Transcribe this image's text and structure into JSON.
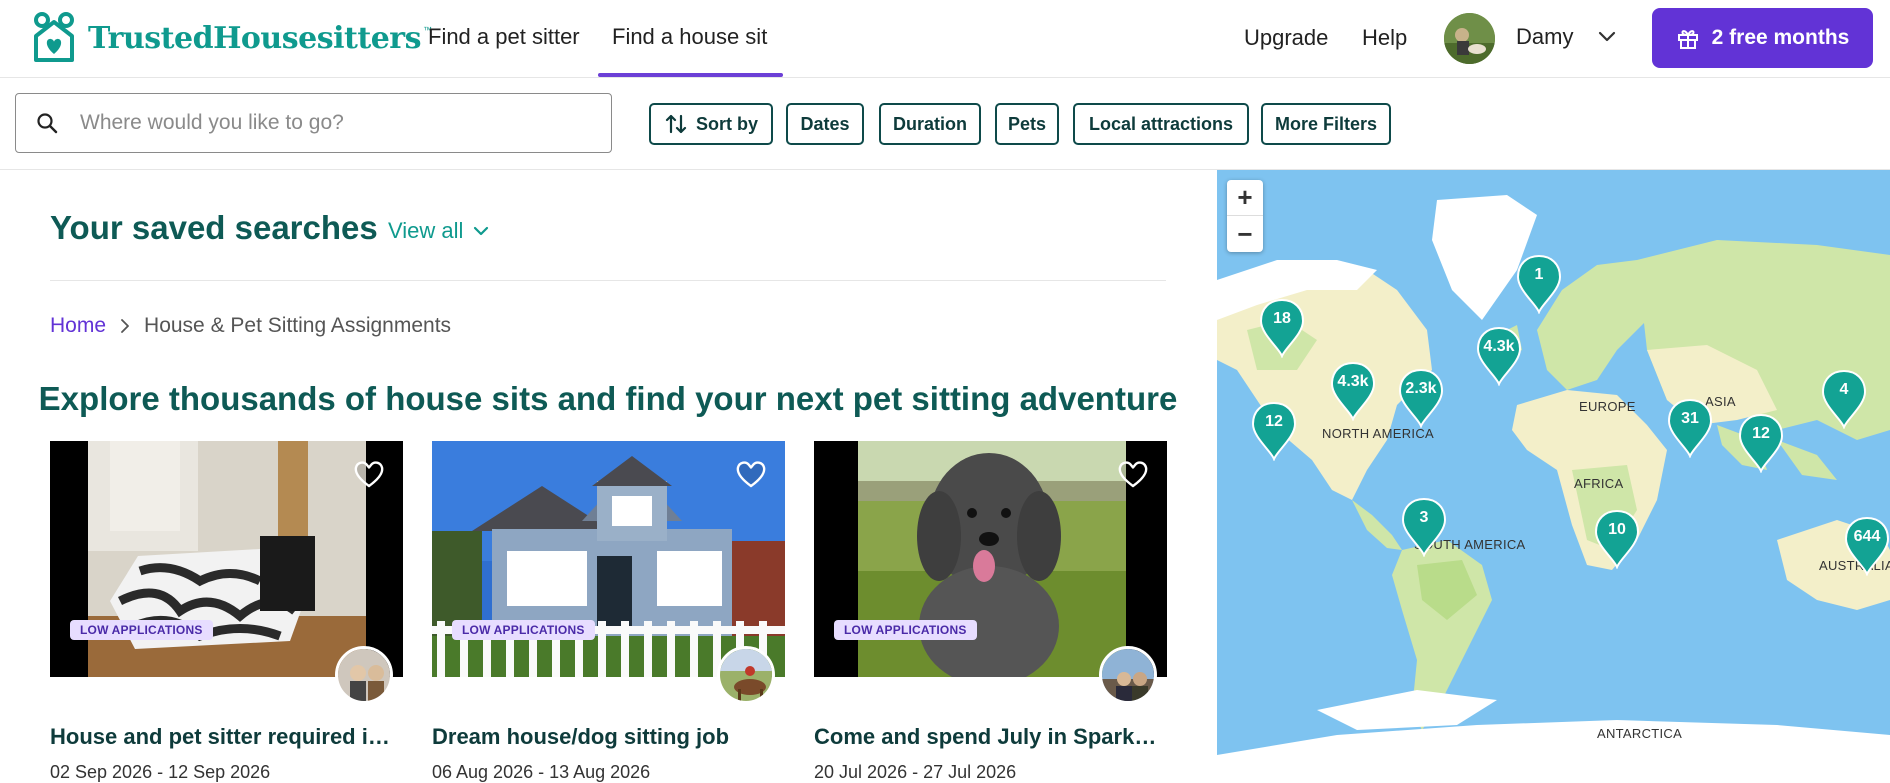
{
  "header": {
    "logo_text": "TrustedHousesitters",
    "logo_tm": "™",
    "nav": [
      {
        "label": "Find a pet sitter"
      },
      {
        "label": "Find a house sit"
      }
    ],
    "upgrade": "Upgrade",
    "help": "Help",
    "user_name": "Damy",
    "cta_label": "2 free months"
  },
  "filters": {
    "search_placeholder": "Where would you like to go?",
    "chips": [
      "Sort by",
      "Dates",
      "Duration",
      "Pets",
      "Local attractions",
      "More Filters"
    ]
  },
  "saved": {
    "title": "Your saved searches",
    "view_all": "View all"
  },
  "breadcrumb": {
    "home": "Home",
    "current": "House & Pet Sitting Assignments"
  },
  "headline": "Explore thousands of house sits and find your next pet sitting adventure",
  "cards": [
    {
      "badge": "LOW APPLICATIONS",
      "title": "House and pet sitter required in Par…",
      "dates": "02 Sep 2026 - 12 Sep 2026"
    },
    {
      "badge": "LOW APPLICATIONS",
      "title": "Dream house/dog sitting job",
      "dates": "06 Aug 2026 - 13 Aug 2026"
    },
    {
      "badge": "LOW APPLICATIONS",
      "title": "Come and spend July in Sparks NV",
      "dates": "20 Jul 2026 - 27 Jul 2026"
    }
  ],
  "map": {
    "zoom_in": "+",
    "zoom_out": "−",
    "clusters": [
      "18",
      "12",
      "4.3k",
      "2.3k",
      "1",
      "4.3k",
      "31",
      "12",
      "4",
      "3",
      "10",
      "644"
    ],
    "regions": [
      "NORTH AMERICA",
      "EUROPE",
      "ASIA",
      "AFRICA",
      "SOUTH AMERICA",
      "AUSTRALIA",
      "ANTARCTICA"
    ]
  },
  "colors": {
    "brand_teal": "#0f9a8e",
    "dark_teal": "#0e5a55",
    "accent_purple": "#6233d6",
    "ocean": "#7ec3f0",
    "pin": "#13a394"
  }
}
